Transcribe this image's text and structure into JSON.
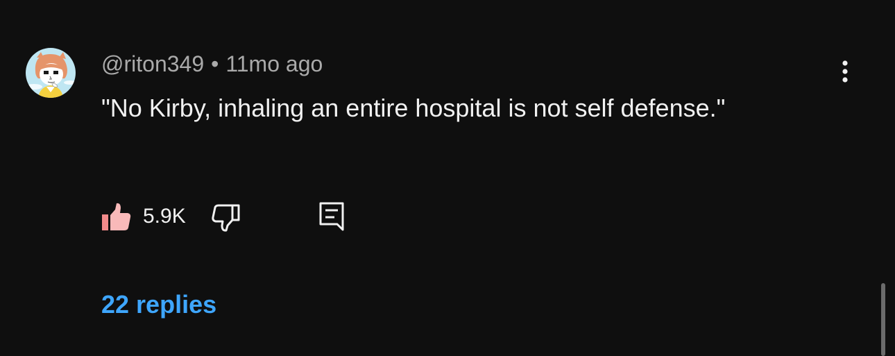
{
  "comment": {
    "author": "@riton349",
    "separator": "•",
    "timestamp": "11mo ago",
    "text": "\"No Kirby, inhaling an entire hospital is not self defense.\"",
    "like_count": "5.9K",
    "replies_label": "22 replies"
  },
  "icons": {
    "like": "thumbs-up-icon",
    "dislike": "thumbs-down-icon",
    "reply": "reply-comment-icon",
    "more": "more-vertical-icon"
  },
  "colors": {
    "background": "#0f0f0f",
    "text": "#f1f1f1",
    "meta": "#aaaaaa",
    "link": "#3ea6ff",
    "like_fill": "#f9b9b9",
    "like_cuff": "#f28a8a"
  }
}
